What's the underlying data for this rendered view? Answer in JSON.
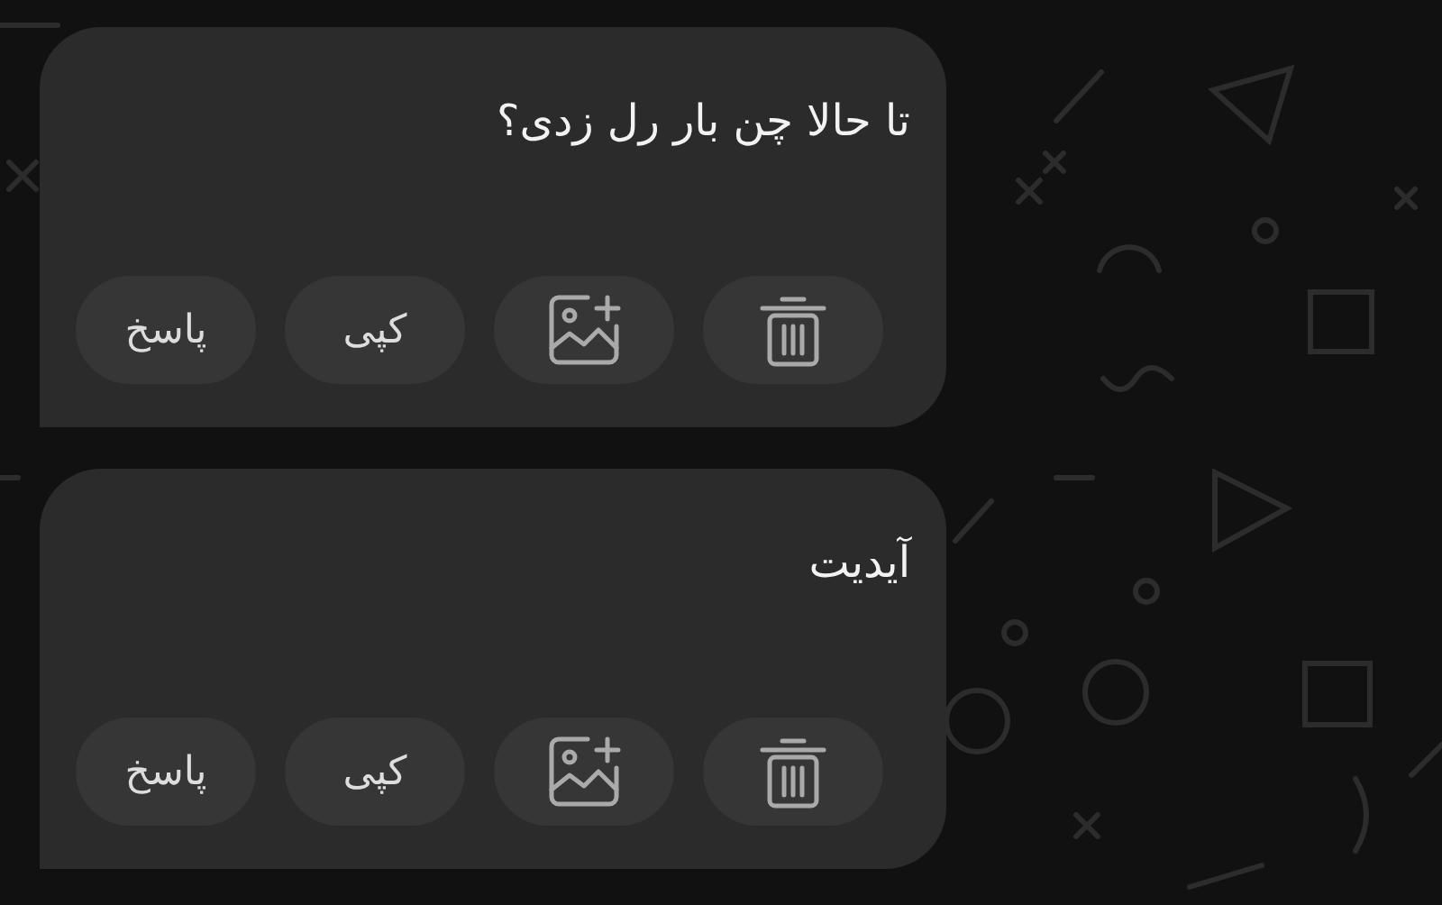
{
  "messages": [
    {
      "text": "تا حالا چن بار رل زدی؟",
      "actions": [
        {
          "kind": "delete"
        },
        {
          "kind": "add-image"
        },
        {
          "kind": "copy",
          "label": "کپی"
        },
        {
          "kind": "reply",
          "label": "پاسخ"
        }
      ]
    },
    {
      "text": "آیدیت",
      "actions": [
        {
          "kind": "delete"
        },
        {
          "kind": "add-image"
        },
        {
          "kind": "copy",
          "label": "کپی"
        },
        {
          "kind": "reply",
          "label": "پاسخ"
        }
      ]
    }
  ]
}
